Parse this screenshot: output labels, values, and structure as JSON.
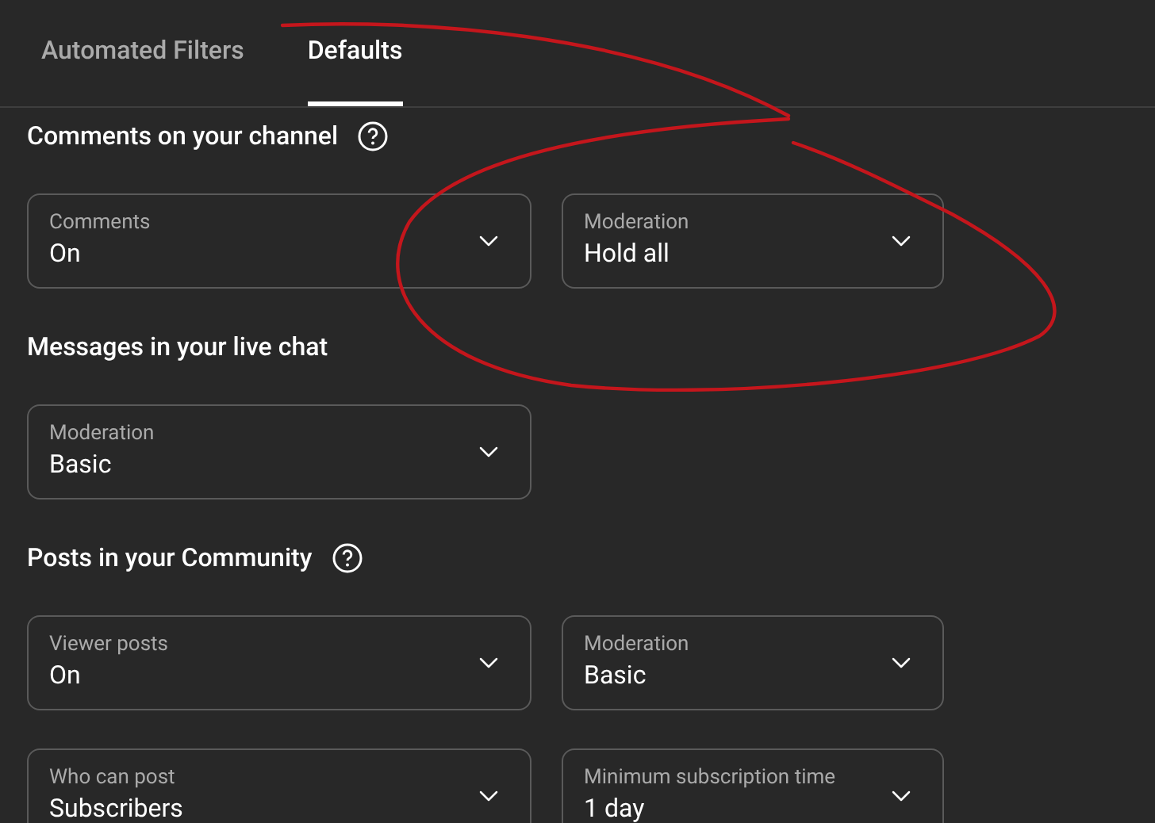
{
  "tabs": [
    {
      "label": "Automated Filters",
      "selected": false
    },
    {
      "label": "Defaults",
      "selected": true
    }
  ],
  "sections": [
    {
      "title": "Comments on your channel",
      "help": true,
      "rows": [
        [
          {
            "label": "Comments",
            "value": "On"
          },
          {
            "label": "Moderation",
            "value": "Hold all"
          }
        ]
      ]
    },
    {
      "title": "Messages in your live chat",
      "help": false,
      "rows": [
        [
          {
            "label": "Moderation",
            "value": "Basic"
          }
        ]
      ]
    },
    {
      "title": "Posts in your Community",
      "help": true,
      "rows": [
        [
          {
            "label": "Viewer posts",
            "value": "On"
          },
          {
            "label": "Moderation",
            "value": "Basic"
          }
        ],
        [
          {
            "label": "Who can post",
            "value": "Subscribers"
          },
          {
            "label": "Minimum subscription time",
            "value": "1 day"
          }
        ]
      ]
    }
  ]
}
